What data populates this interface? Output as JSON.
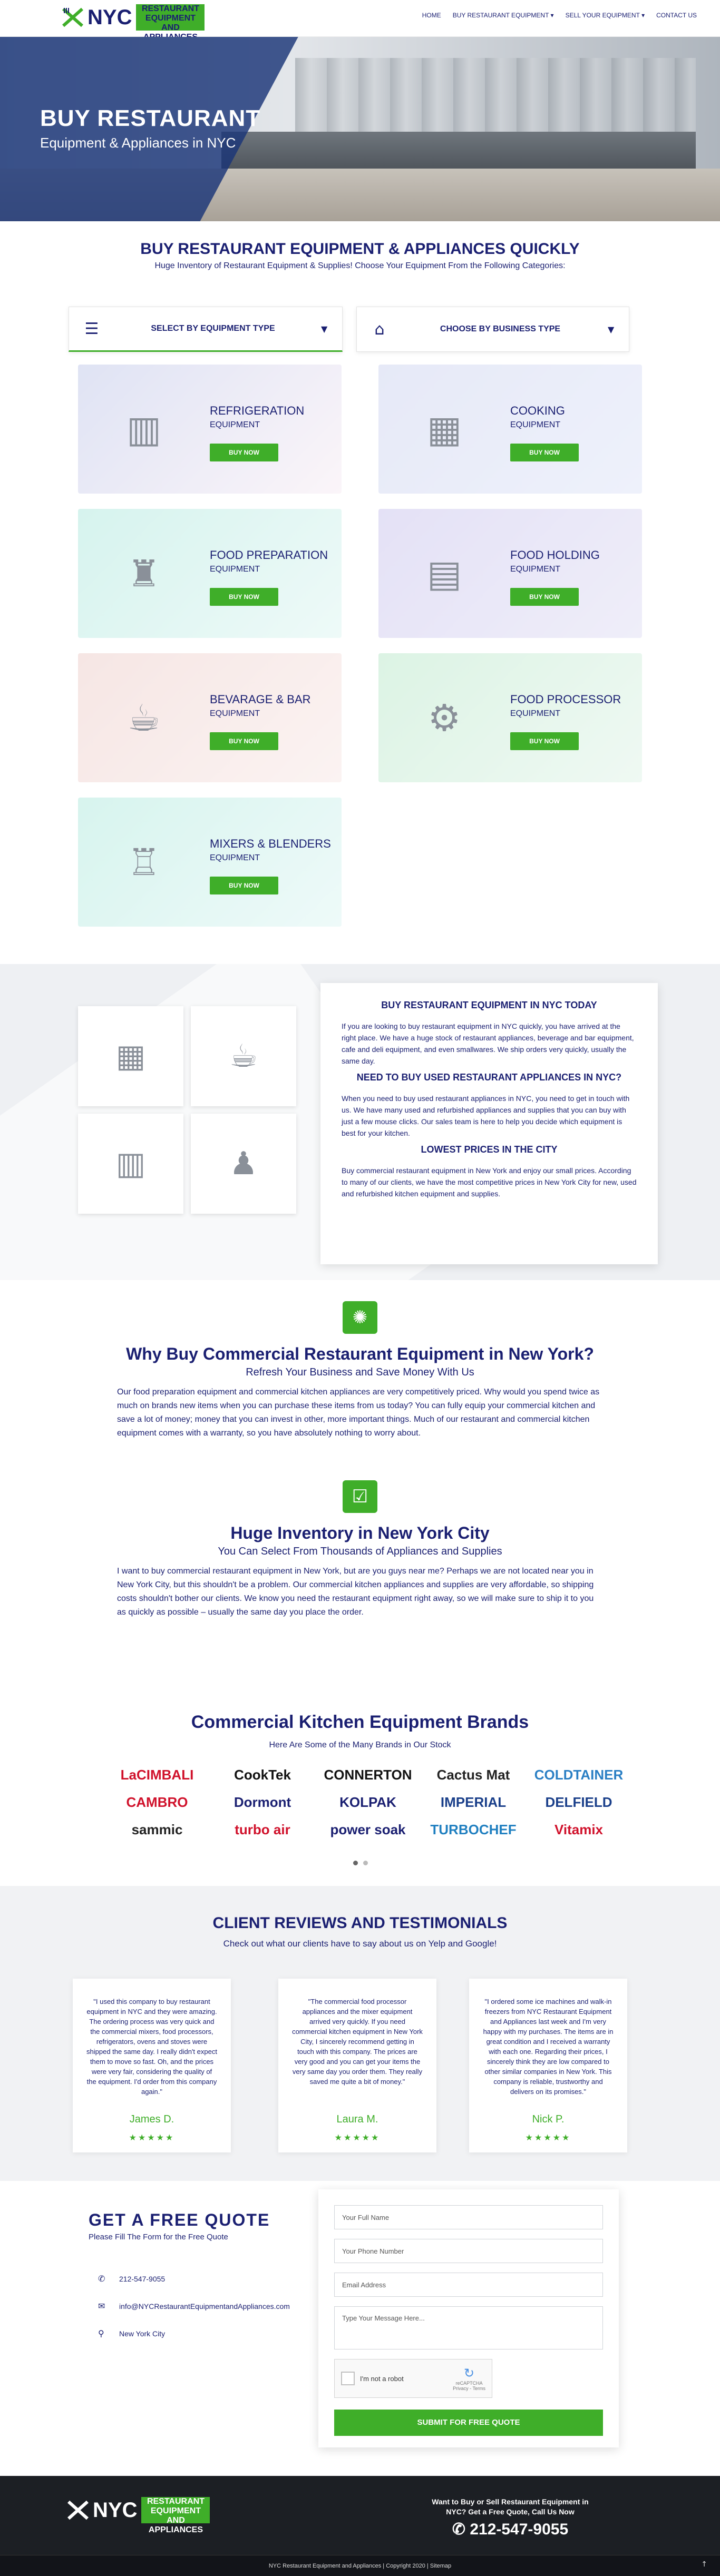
{
  "header": {
    "logo_nyc": "NYC",
    "logo_sub": "Restaurant Equipment and Appliances",
    "nav": [
      "HOME",
      "BUY RESTAURANT EQUIPMENT",
      "SELL YOUR EQUIPMENT",
      "CONTACT US"
    ],
    "accent": "#3fae29",
    "brand": "#1a1f71"
  },
  "hero": {
    "title": "BUY RESTAURANT",
    "subtitle": "Equipment & Appliances in NYC"
  },
  "categories": {
    "title": "BUY RESTAURANT EQUIPMENT & APPLIANCES QUICKLY",
    "lead": "Huge Inventory of Restaurant Equipment & Supplies! Choose Your Equipment From the Following Categories:",
    "select_type": "SELECT BY EQUIPMENT TYPE",
    "select_business": "CHOOSE BY BUSINESS TYPE",
    "buy_label": "BUY NOW",
    "sub": "EQUIPMENT",
    "items": [
      {
        "title": "REFRIGERATION"
      },
      {
        "title": "COOKING"
      },
      {
        "title": "FOOD PREPARATION"
      },
      {
        "title": "FOOD HOLDING"
      },
      {
        "title": "BEVARAGE & BAR"
      },
      {
        "title": "FOOD PROCESSOR"
      },
      {
        "title": "MIXERS & BLENDERS"
      }
    ]
  },
  "today": {
    "h1": "BUY RESTAURANT EQUIPMENT IN NYC TODAY",
    "p1": "If you are looking to buy restaurant equipment in NYC quickly, you have arrived at the right place. We have a huge stock of restaurant appliances, beverage and bar equipment, cafe and deli equipment, and even smallwares. We ship orders very quickly, usually the same day.",
    "h2": "NEED TO BUY USED RESTAURANT APPLIANCES IN NYC?",
    "p2": "When you need to buy used restaurant appliances in NYC, you need to get in touch with us. We have many used and refurbished appliances and supplies that you can buy with just a few mouse clicks. Our sales team is here to help you decide which equipment is best for your kitchen.",
    "h3": "LOWEST PRICES IN THE CITY",
    "p3": "Buy commercial restaurant equipment in New York and enjoy our small prices. According to many of our clients, we have the most competitive prices in New York City for new, used and refurbished kitchen equipment and supplies."
  },
  "why": {
    "title": "Why Buy Commercial Restaurant Equipment in New York?",
    "sub": "Refresh Your Business and Save Money With Us",
    "p": "Our food preparation equipment and commercial kitchen appliances are very competitively priced. Why would you spend twice as much on brands new items when you can purchase these items from us today? You can fully equip your commercial kitchen and save a lot of money; money that you can invest in other, more important things. Much of our restaurant and commercial kitchen equipment comes with a warranty, so you have absolutely nothing to worry about.",
    "title2": "Huge Inventory in New York City",
    "sub2": "You Can Select From Thousands of Appliances and Supplies",
    "p2": "I want to buy commercial restaurant equipment in New York, but are you guys near me? Perhaps we are not located near you in New York City, but this shouldn't be a problem. Our commercial kitchen appliances and supplies are very affordable, so shipping costs shouldn't bother our clients. We know you need the restaurant equipment right away, so we will make sure to ship it to you as quickly as possible – usually the same day you place the order."
  },
  "brands": {
    "title": "Commercial Kitchen Equipment Brands",
    "lead": "Here Are Some of the Many Brands in Our Stock",
    "items": [
      {
        "name": "LaCIMBALI",
        "color": "#d0112b"
      },
      {
        "name": "CookTek",
        "color": "#111111"
      },
      {
        "name": "CONNERTON",
        "color": "#111111"
      },
      {
        "name": "Cactus Mat",
        "color": "#222222"
      },
      {
        "name": "COLDTAINER",
        "color": "#2a7fc4"
      },
      {
        "name": "CAMBRO",
        "color": "#d0112b"
      },
      {
        "name": "Dormont",
        "color": "#1a1f71"
      },
      {
        "name": "KOLPAK",
        "color": "#1a1f71"
      },
      {
        "name": "IMPERIAL",
        "color": "#1a3f8a"
      },
      {
        "name": "DELFIELD",
        "color": "#1a3f8a"
      },
      {
        "name": "sammic",
        "color": "#222222"
      },
      {
        "name": "turbo air",
        "color": "#d0112b"
      },
      {
        "name": "power soak",
        "color": "#1a1f71"
      },
      {
        "name": "TURBOCHEF",
        "color": "#1f7fc0"
      },
      {
        "name": "Vitamix",
        "color": "#d0112b"
      }
    ]
  },
  "reviews": {
    "title": "CLIENT REVIEWS AND TESTIMONIALS",
    "lead": "Check out what our clients have to say about us on Yelp and Google!",
    "stars": "★★★★★",
    "items": [
      {
        "quote": "\"I used this company to buy restaurant equipment in NYC and they were amazing. The ordering process was very quick and the commercial mixers, food processors, refrigerators, ovens and stoves were shipped the same day. I really didn't expect them to move so fast. Oh, and the prices were very fair, considering the quality of the equipment. I'd order from this company again.\"",
        "name": "James D."
      },
      {
        "quote": "\"The commercial food processor appliances and the mixer equipment arrived very quickly. If you need commercial kitchen equipment in New York City, I sincerely recommend getting in touch with this company. The prices are very good and you can get your items the very same day you order them. They really saved me quite a bit of money.\"",
        "name": "Laura M."
      },
      {
        "quote": "\"I ordered some ice machines and walk-in freezers from NYC Restaurant Equipment and Appliances last week and I'm very happy with my purchases. The items are in great condition and I received a warranty with each one. Regarding their prices, I sincerely think they are low compared to other similar companies in New York. This company is reliable, trustworthy and delivers on its promises.\"",
        "name": "Nick P."
      }
    ]
  },
  "quote": {
    "title": "GET A FREE QUOTE",
    "lead": "Please Fill The Form for the Free Quote",
    "phone": "212-547-9055",
    "email": "info@NYCRestaurantEquipmentandAppliances.com",
    "location": "New York City",
    "name_ph": "Your Full Name",
    "phone_ph": "Your Phone Number",
    "email_ph": "Email Address",
    "msg_ph": "Type Your Message Here...",
    "captcha": "I'm not a robot",
    "captcha_brand": "reCAPTCHA",
    "captcha_links": "Privacy - Terms",
    "submit": "SUBMIT FOR FREE QUOTE"
  },
  "footer": {
    "cta": "Want to Buy or Sell Restaurant Equipment in NYC? Get a Free Quote, Call Us Now",
    "phone": "212-547-9055",
    "copyright": "NYC Restaurant Equipment and Appliances | Copyright 2020 | Sitemap",
    "top": "↑"
  }
}
